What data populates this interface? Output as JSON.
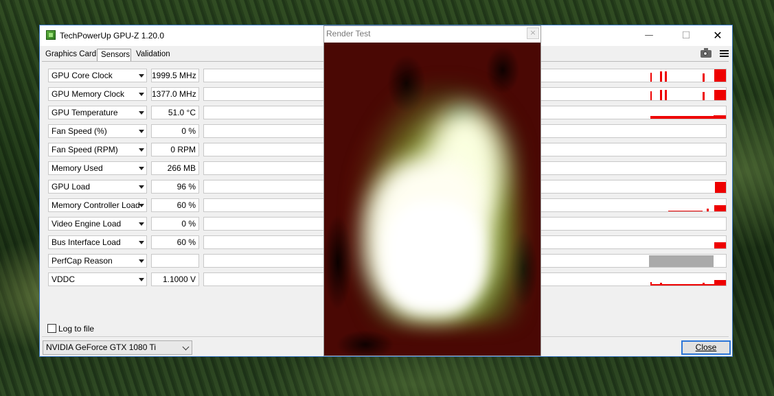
{
  "gpuz": {
    "title": "TechPowerUp GPU-Z 1.20.0",
    "tabs": [
      "Graphics Card",
      "Sensors",
      "Validation"
    ],
    "active_tab": "Sensors",
    "sensors": [
      {
        "label": "GPU Core Clock",
        "value": "1999.5 MHz"
      },
      {
        "label": "GPU Memory Clock",
        "value": "1377.0 MHz"
      },
      {
        "label": "GPU Temperature",
        "value": "51.0 °C"
      },
      {
        "label": "Fan Speed (%)",
        "value": "0 %"
      },
      {
        "label": "Fan Speed (RPM)",
        "value": "0 RPM"
      },
      {
        "label": "Memory Used",
        "value": "266 MB"
      },
      {
        "label": "GPU Load",
        "value": "96 %"
      },
      {
        "label": "Memory Controller Load",
        "value": "60 %"
      },
      {
        "label": "Video Engine Load",
        "value": "0 %"
      },
      {
        "label": "Bus Interface Load",
        "value": "60 %"
      },
      {
        "label": "PerfCap Reason",
        "value": ""
      },
      {
        "label": "VDDC",
        "value": "1.1000 V"
      }
    ],
    "log_to_file": {
      "label": "Log to file",
      "checked": false
    },
    "gpu_select": "NVIDIA GeForce GTX 1080 Ti",
    "close_label": "Close"
  },
  "render_test": {
    "title": "Render Test",
    "close_glyph": "×"
  },
  "icons": {
    "app": "gpuz-app-icon",
    "camera": "camera-icon",
    "menu": "hamburger-menu-icon",
    "minimize": "minimize-icon",
    "maximize": "maximize-icon",
    "close": "close-icon"
  },
  "colors": {
    "graph": "#ee0000",
    "perfcap": "#aaaaaa",
    "accent": "#2c76d8"
  }
}
